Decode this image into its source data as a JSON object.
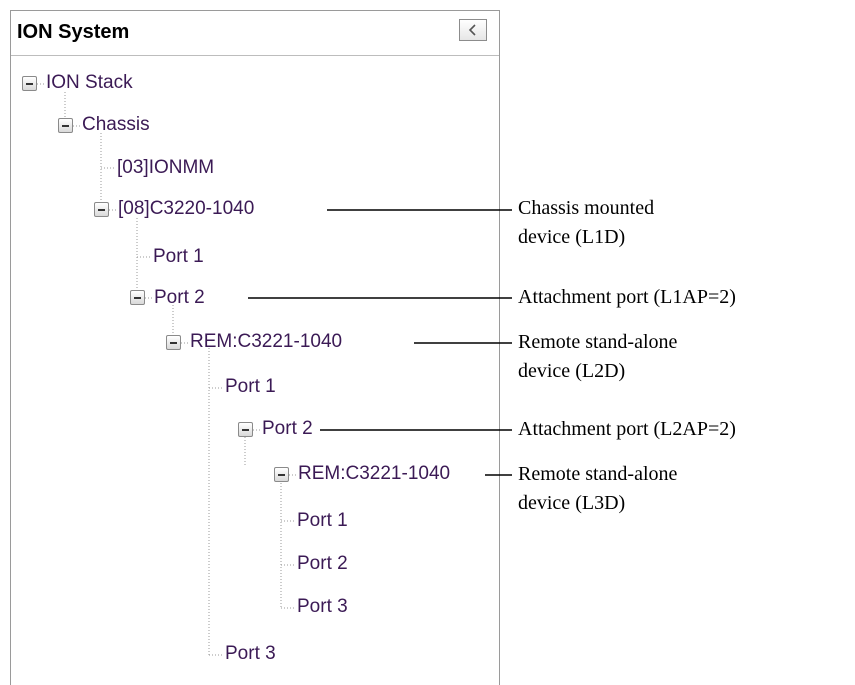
{
  "panel": {
    "title": "ION System",
    "collapse_icon": "chevron-left-icon"
  },
  "tree": {
    "root": "ION Stack",
    "chassis": "Chassis",
    "ionmm": "[03]IONMM",
    "c3220": "[08]C3220-1040",
    "c3220_port1": "Port 1",
    "c3220_port2": "Port 2",
    "rem1": "REM:C3221-1040",
    "rem1_port1": "Port 1",
    "rem1_port2": "Port 2",
    "rem2": "REM:C3221-1040",
    "rem2_port1": "Port 1",
    "rem2_port2": "Port 2",
    "rem2_port3": "Port 3",
    "rem1_port3": "Port 3"
  },
  "annotations": {
    "chassis_device": [
      "Chassis mounted",
      "device (L1D)"
    ],
    "l1ap": "Attachment port (L1AP=2)",
    "l2d": [
      "Remote stand-alone",
      "device (L2D)"
    ],
    "l2ap": "Attachment port (L2AP=2)",
    "l3d": [
      "Remote stand-alone",
      "device (L3D)"
    ]
  }
}
